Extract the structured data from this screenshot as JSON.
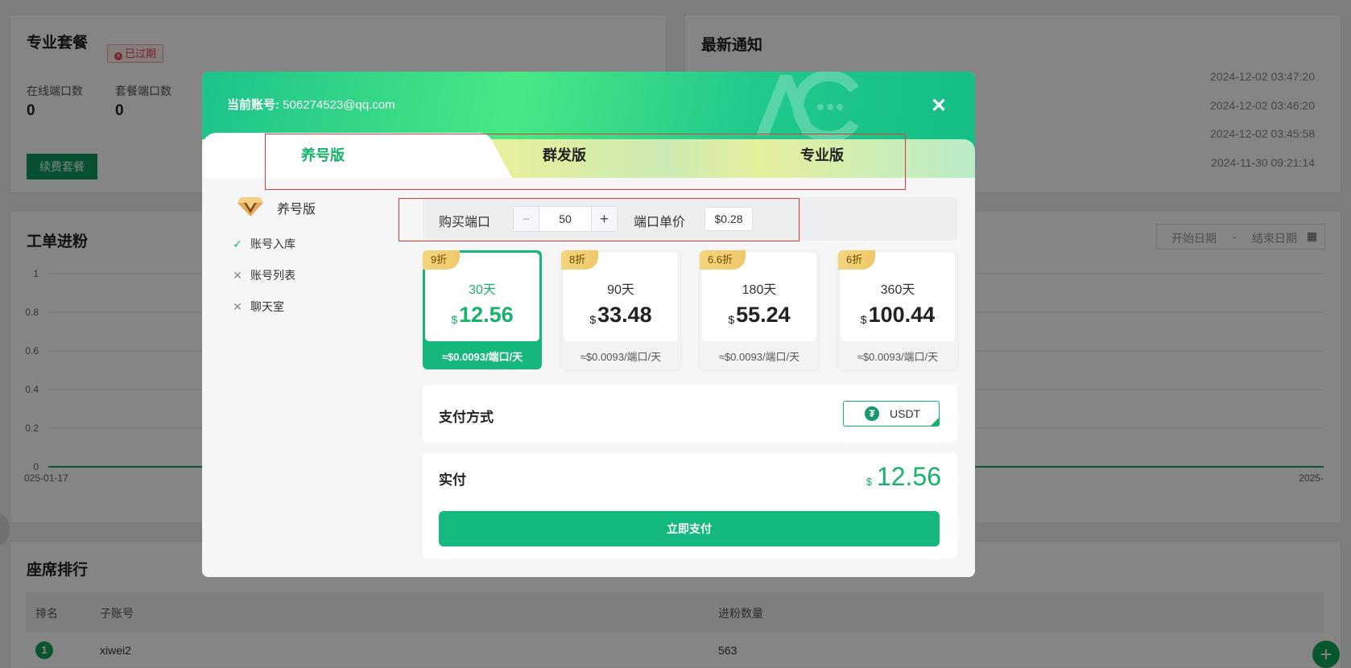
{
  "dashboard": {
    "package_card": {
      "title": "专业套餐",
      "badge": "已过期",
      "online_ports_label": "在线端口数",
      "online_ports_value": "0",
      "package_ports_label": "套餐端口数",
      "package_ports_value": "0",
      "renew_label": "续费套餐"
    },
    "notice_card": {
      "title": "最新通知",
      "dates": [
        "2024-12-02 03:47:20",
        "2024-12-02 03:46:20",
        "2024-12-02 03:45:58",
        "2024-11-30 09:21:14"
      ]
    },
    "work_order_card": {
      "title": "工单进粉",
      "start_date_placeholder": "开始日期",
      "range_sep": "-",
      "end_date_placeholder": "结束日期"
    },
    "chart_data": {
      "type": "line",
      "yticks": [
        "1",
        "0.8",
        "0.6",
        "0.4",
        "0.2",
        "0"
      ],
      "x_first": "025-01-17",
      "x_last": "2025-",
      "ylim": [
        0,
        1
      ],
      "series": [
        {
          "values": [
            0,
            0
          ]
        }
      ]
    },
    "ranking_card": {
      "title": "座席排行",
      "columns": [
        "排名",
        "子账号",
        "进粉数量"
      ],
      "rows": [
        {
          "rank": "1",
          "account": "xiwei2",
          "count": "563"
        }
      ]
    }
  },
  "modal": {
    "account_label": "当前账号:",
    "account_value": "506274523@qq.com",
    "close_icon": "close-icon",
    "tabs": [
      {
        "label": "养号版",
        "active": true
      },
      {
        "label": "群发版",
        "active": false
      },
      {
        "label": "专业版",
        "active": false
      }
    ],
    "plan": {
      "name": "养号版",
      "features": [
        {
          "label": "账号入库",
          "included": true
        },
        {
          "label": "账号列表",
          "included": false
        },
        {
          "label": "聊天室",
          "included": false
        }
      ]
    },
    "quantity": {
      "label": "购买端口",
      "minus": "−",
      "plus": "+",
      "value": "50",
      "unit_price_label": "端口单价",
      "unit_price_value": "$0.28"
    },
    "cards": [
      {
        "discount": "9折",
        "days": "30天",
        "currency": "$",
        "price": "12.56",
        "per_day": "≈$0.0093/端口/天",
        "selected": true
      },
      {
        "discount": "8折",
        "days": "90天",
        "currency": "$",
        "price": "33.48",
        "per_day": "≈$0.0093/端口/天",
        "selected": false
      },
      {
        "discount": "6.6折",
        "days": "180天",
        "currency": "$",
        "price": "55.24",
        "per_day": "≈$0.0093/端口/天",
        "selected": false
      },
      {
        "discount": "6折",
        "days": "360天",
        "currency": "$",
        "price": "100.44",
        "per_day": "≈$0.0093/端口/天",
        "selected": false
      }
    ],
    "payment": {
      "label": "支付方式",
      "method": "USDT",
      "method_icon_glyph": "₮"
    },
    "total": {
      "label": "实付",
      "currency": "$",
      "amount": "12.56",
      "pay_button": "立即支付"
    },
    "colors": {
      "accent": "#17b36b",
      "highlight": "#e53935",
      "discount_tag": "#f0c86a"
    }
  }
}
